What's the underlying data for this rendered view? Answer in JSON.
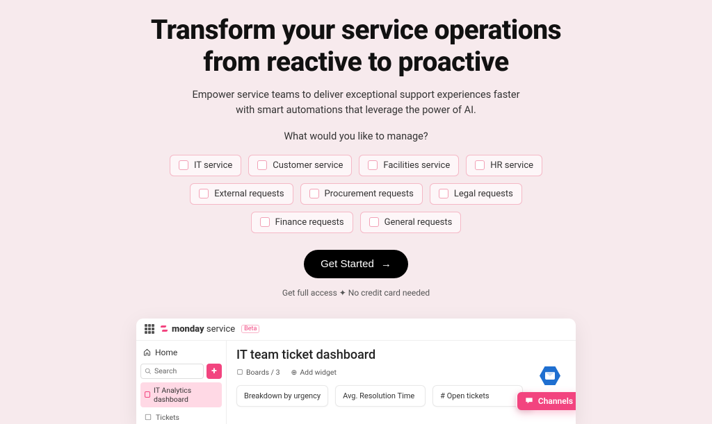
{
  "hero": {
    "title_line1": "Transform your service operations",
    "title_line2": "from reactive to proactive",
    "sub_line1": "Empower service teams to deliver exceptional support experiences faster",
    "sub_line2": "with smart automations that leverage the power of AI.",
    "prompt": "What would you like to manage?",
    "chips": [
      "IT service",
      "Customer service",
      "Facilities service",
      "HR service",
      "External requests",
      "Procurement requests",
      "Legal requests",
      "Finance requests",
      "General requests"
    ],
    "cta": "Get Started",
    "fineprint": "Get full access ✦ No credit card needed"
  },
  "app": {
    "brand_strong": "monday",
    "brand_light": " service",
    "brand_badge": "Beta",
    "sidebar": {
      "home": "Home",
      "search_placeholder": "Search",
      "active_item": "IT Analytics dashboard",
      "tickets": "Tickets"
    },
    "main": {
      "title": "IT team ticket dashboard",
      "boards_label": "Boards / 3",
      "add_widget": "Add widget",
      "cards": [
        "Breakdown by urgency",
        "Avg. Resolution Time",
        "# Open tickets"
      ]
    },
    "channels_label": "Channels"
  }
}
